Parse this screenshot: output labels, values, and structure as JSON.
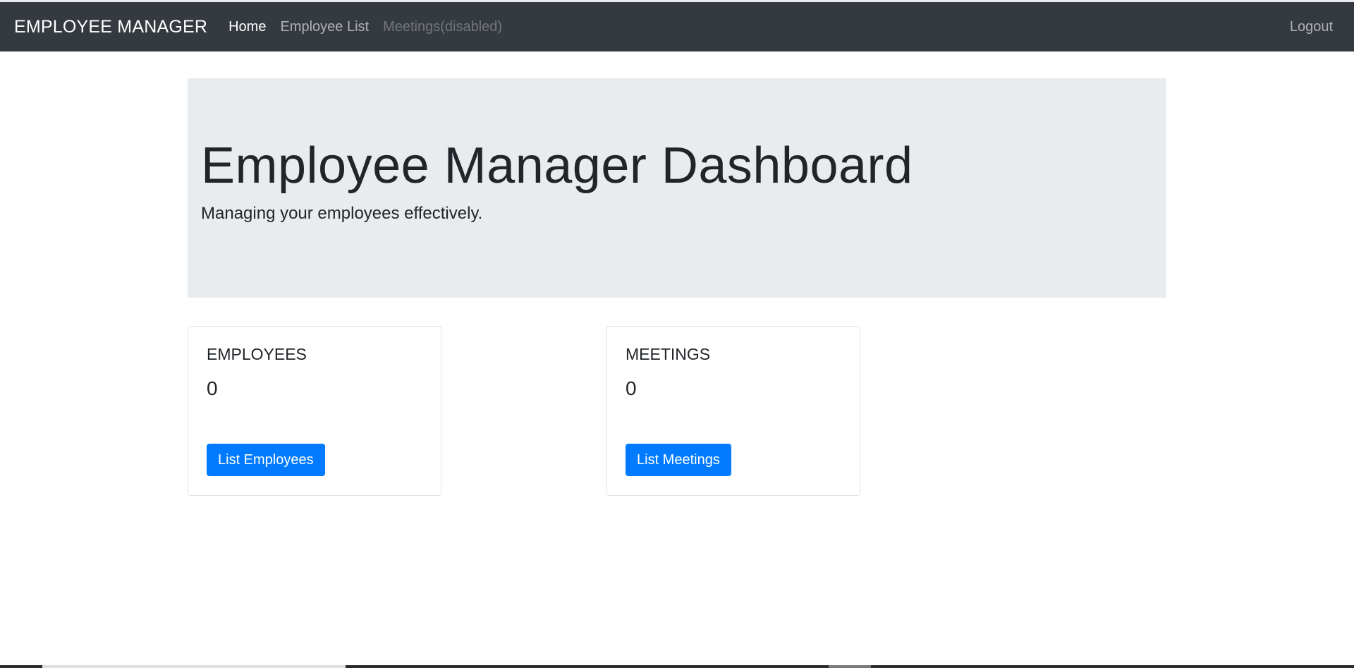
{
  "navbar": {
    "brand": "EMPLOYEE MANAGER",
    "links": [
      {
        "label": "Home",
        "state": "active"
      },
      {
        "label": "Employee List",
        "state": "normal"
      },
      {
        "label": "Meetings(disabled)",
        "state": "disabled"
      }
    ],
    "logout_label": "Logout"
  },
  "jumbotron": {
    "title": "Employee Manager Dashboard",
    "subtitle": "Managing your employees effectively."
  },
  "cards": [
    {
      "title": "EMPLOYEES",
      "count": "0",
      "button_label": "List Employees"
    },
    {
      "title": "MEETINGS",
      "count": "0",
      "button_label": "List Meetings"
    }
  ],
  "colors": {
    "navbar_bg": "#343a40",
    "jumbotron_bg": "#e9ecef",
    "primary_button": "#007bff"
  }
}
